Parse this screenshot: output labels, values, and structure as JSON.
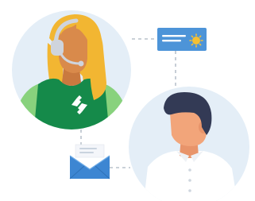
{
  "illustration": {
    "subject": "",
    "colors": {
      "background": "#ffffff",
      "circle_fill": "#e4eef7",
      "connector": "#b9c2cc",
      "card_blue": "#4d94d8",
      "card_line": "#ffffff",
      "sun": "#f5c033",
      "hair_yellow": "#f2b632",
      "skin_agent": "#d98a4b",
      "shirt_green": "#158a4a",
      "sleeve_green": "#88d27d",
      "headset_gray": "#cfd4dc",
      "skin_customer": "#f2a57a",
      "hair_dark": "#333a55",
      "shirt_white": "#ffffff",
      "envelope_blue": "#3d86d2",
      "envelope_flap": "#72aee8",
      "letter": "#f4f6fa"
    },
    "icons": [
      "headset-icon",
      "id-card-icon",
      "envelope-icon",
      "logo-icon"
    ]
  }
}
